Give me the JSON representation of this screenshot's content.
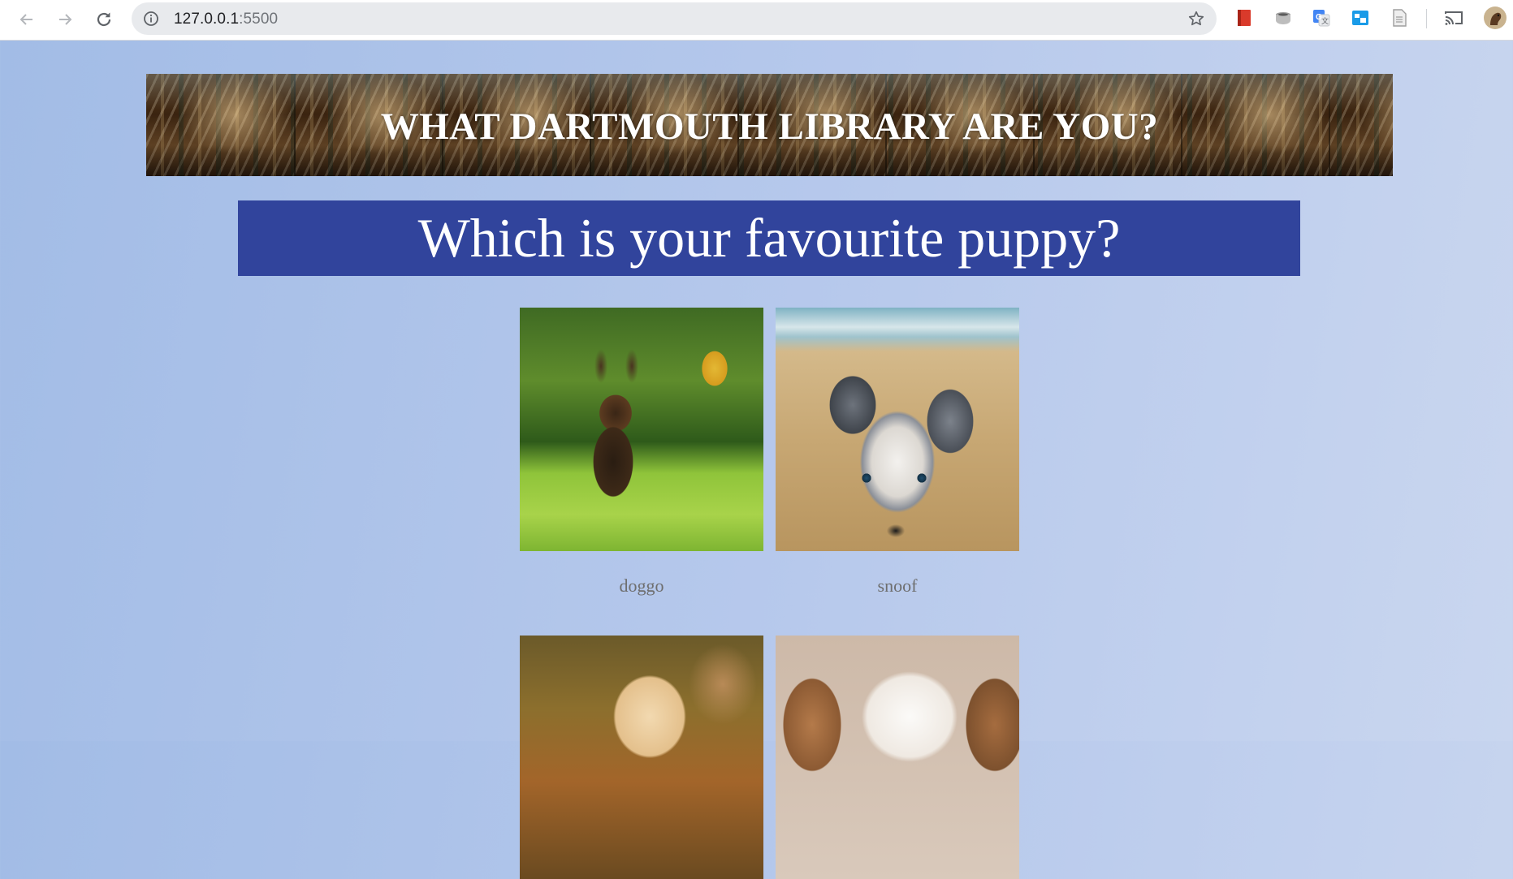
{
  "browser": {
    "url_host": "127.0.0.1",
    "url_port": ":5500",
    "icons": [
      "back-arrow-icon",
      "forward-arrow-icon",
      "reload-icon",
      "site-info-icon",
      "bookmark-star-icon",
      "cast-icon",
      "profile-avatar-icon"
    ],
    "extensions": [
      "red-book-extension-icon",
      "cup-extension-icon",
      "google-translate-extension-icon",
      "window-extension-icon",
      "document-extension-icon"
    ]
  },
  "page": {
    "banner_title": "WHAT DARTMOUTH LIBRARY ARE YOU?",
    "question": "Which is your favourite puppy?",
    "options": [
      {
        "caption": "doggo",
        "image": "german-shepherd-puppy-running-on-grass"
      },
      {
        "caption": "snoof",
        "image": "australian-shepherd-puppy-in-sand"
      },
      {
        "caption": "",
        "image": "golden-retriever-puppy"
      },
      {
        "caption": "",
        "image": "fluffy-white-brown-puppy"
      }
    ]
  },
  "colors": {
    "question_bg": "#31449c",
    "page_bg": "#a9c0e8",
    "caption_text": "#6e6e6e"
  }
}
